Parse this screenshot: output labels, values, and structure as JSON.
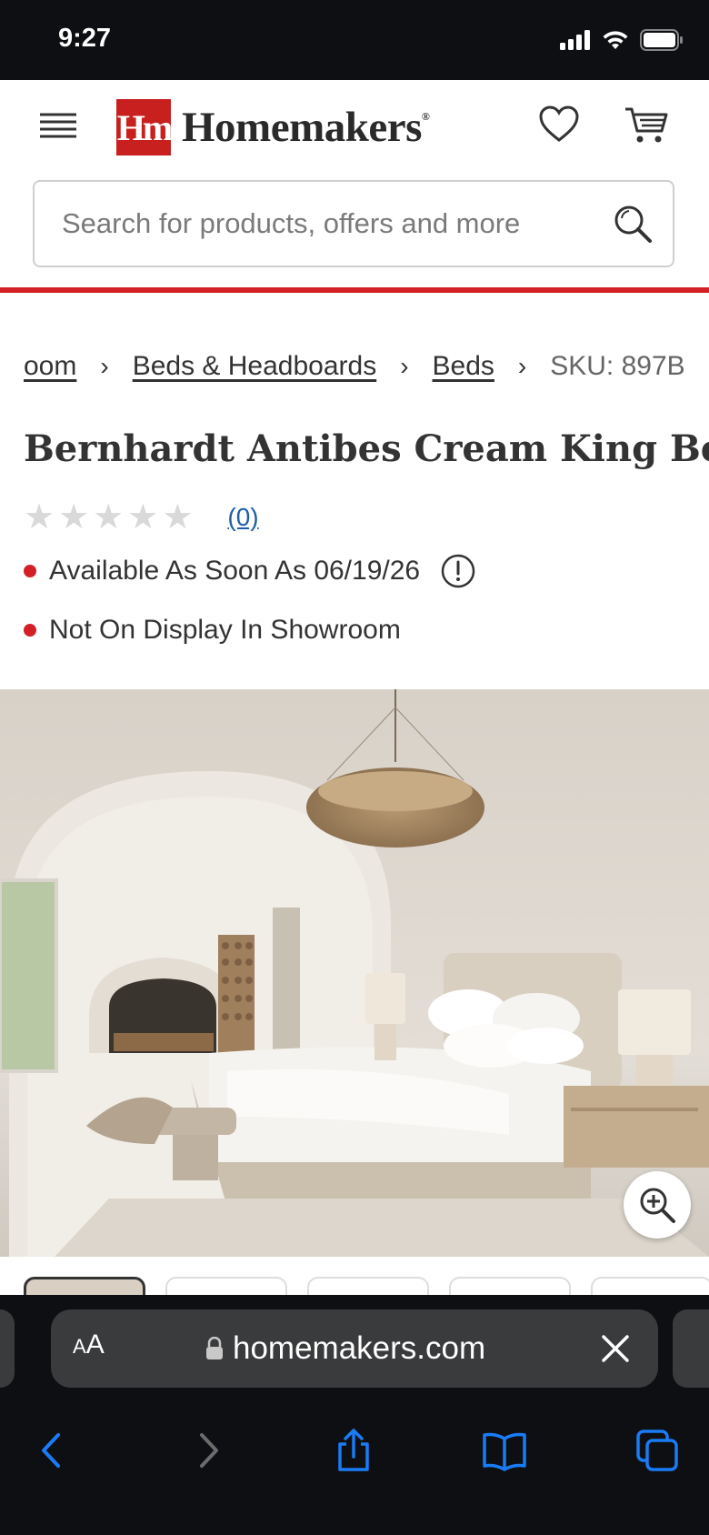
{
  "status_bar": {
    "time": "9:27"
  },
  "header": {
    "logo_mark": "Hm",
    "logo_text": "Homemakers",
    "logo_reg": "®"
  },
  "search": {
    "placeholder": "Search for products, offers and more"
  },
  "breadcrumb": {
    "items": [
      "oom",
      "Beds & Headboards",
      "Beds"
    ],
    "sku": "SKU: 897B"
  },
  "product": {
    "title": "Bernhardt Antibes Cream King Bed",
    "rating": 0,
    "review_count": "(0)",
    "availability": "Available As Soon As 06/19/26",
    "display_status": "Not On Display In Showroom"
  },
  "gallery": {
    "thumbnail_count": 5,
    "active_index": 0
  },
  "browser": {
    "aa_label_small": "A",
    "aa_label": "A",
    "url": "homemakers.com"
  },
  "colors": {
    "brand_red": "#d32026",
    "link_blue": "#1f5fa8",
    "ios_blue": "#1a7cf5"
  }
}
